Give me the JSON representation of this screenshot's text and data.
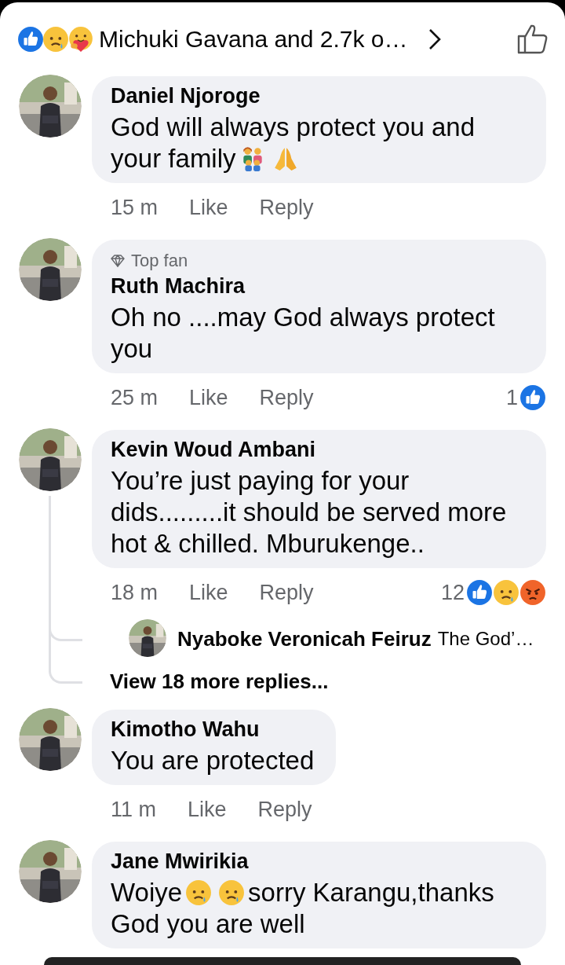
{
  "header": {
    "reactions": [
      {
        "kind": "like"
      },
      {
        "kind": "sad"
      },
      {
        "kind": "care"
      }
    ],
    "summary": "Michuki Gavana and 2.7k o…"
  },
  "comments": [
    {
      "name": "Daniel Njoroge",
      "avatar": {
        "kind": "picture"
      },
      "parts": [
        {
          "kind": "text",
          "text": "God will always protect you and your family"
        },
        {
          "kind": "family"
        },
        {
          "kind": "pray"
        }
      ],
      "time": "15 m",
      "like": "Like",
      "reply": "Reply"
    },
    {
      "name": "Ruth Machira",
      "badge": "Top fan",
      "avatar": {
        "kind": "picture"
      },
      "parts": [
        {
          "kind": "text",
          "text": "Oh no ....may God always protect you"
        }
      ],
      "time": "25 m",
      "like": "Like",
      "reply": "Reply",
      "reaction_count": "1",
      "reactions": [
        {
          "kind": "like"
        }
      ]
    },
    {
      "name": "Kevin Woud Ambani",
      "avatar": {
        "kind": "picture"
      },
      "parts": [
        {
          "kind": "text",
          "text": "You’re just paying for your dids.........it should be served more hot & chilled. Mburukenge.."
        }
      ],
      "time": "18 m",
      "like": "Like",
      "reply": "Reply",
      "reaction_count": "12",
      "reactions": [
        {
          "kind": "like"
        },
        {
          "kind": "sad"
        },
        {
          "kind": "angry"
        }
      ],
      "replies": {
        "items": [
          {
            "name": "Nyaboke Veronicah Feiruz",
            "text": "The God’…",
            "avatar": {
              "kind": "picture"
            }
          }
        ],
        "more": "View 18 more replies..."
      }
    },
    {
      "name": "Kimotho Wahu",
      "avatar": {
        "kind": "picture"
      },
      "parts": [
        {
          "kind": "text",
          "text": "You are protected"
        }
      ],
      "time": "11 m",
      "like": "Like",
      "reply": "Reply"
    },
    {
      "name": "Jane Mwirikia",
      "avatar": {
        "kind": "picture"
      },
      "parts": [
        {
          "kind": "text",
          "text": "Woiye"
        },
        {
          "kind": "sad"
        },
        {
          "kind": "sad"
        },
        {
          "kind": "text",
          "text": "sorry Karangu,thanks God you are well"
        }
      ]
    }
  ]
}
